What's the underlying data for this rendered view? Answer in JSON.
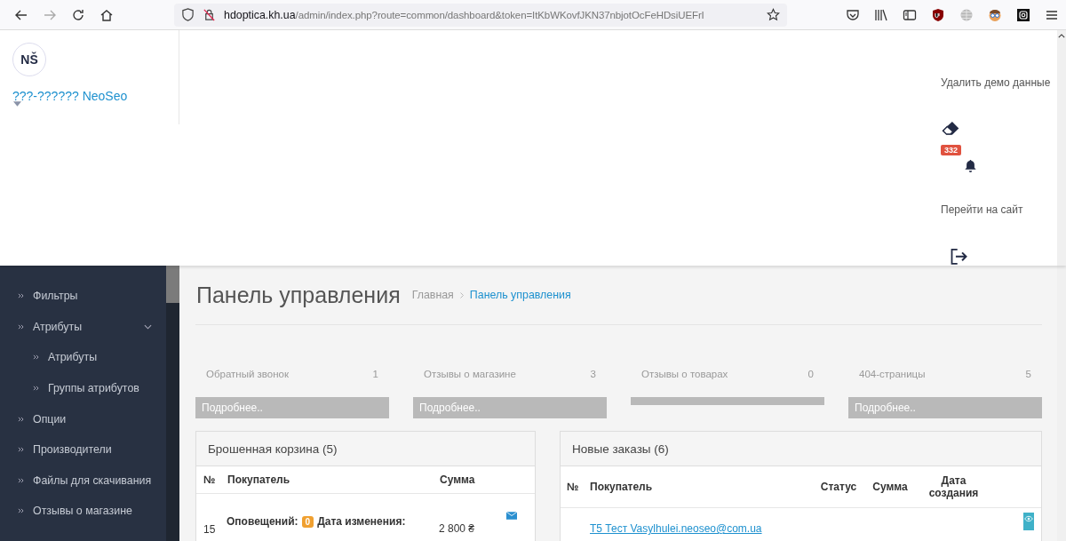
{
  "browser": {
    "url_host": "hdoptica.kh.ua",
    "url_path": "/admin/index.php?route=common/dashboard&token=ItKbWKovfJKN37nbjotOcFeHDsiUEFrI"
  },
  "header": {
    "logo": "NŠ",
    "store_name": "???-?????? NeoSeo",
    "delete_demo": "Удалить демо данные",
    "notifications_count": "332",
    "go_to_site": "Перейти на сайт"
  },
  "sidebar": {
    "items": [
      {
        "label": "Фильтры"
      },
      {
        "label": "Атрибуты",
        "expanded": true,
        "children": [
          {
            "label": "Атрибуты"
          },
          {
            "label": "Группы атрибутов"
          }
        ]
      },
      {
        "label": "Опции"
      },
      {
        "label": "Производители"
      },
      {
        "label": "Файлы для скачивания"
      },
      {
        "label": "Отзывы о магазине"
      }
    ]
  },
  "page": {
    "title": "Панель управления",
    "breadcrumbs": [
      {
        "label": "Главная",
        "selected": false
      },
      {
        "label": "Панель управления",
        "selected": true
      }
    ]
  },
  "stats": [
    {
      "label": "Обратный звонок",
      "count": "1",
      "more": "Подробнее.."
    },
    {
      "label": "Отзывы о магазине",
      "count": "3",
      "more": "Подробнее.."
    },
    {
      "label": "Отзывы о товарах",
      "count": "0"
    },
    {
      "label": "404-страницы",
      "count": "5",
      "more": "Подробнее.."
    }
  ],
  "abandoned_cart": {
    "title": "Брошенная корзина (5)",
    "columns": [
      "№",
      "Покупатель",
      "Сумма"
    ],
    "rows": [
      {
        "number": "15",
        "notifications_label": "Оповещений:",
        "notifications": "0",
        "date_label": "Дата изменения:",
        "sum": "2 800 ₴"
      }
    ]
  },
  "new_orders": {
    "title": "Новые заказы (6)",
    "columns": [
      "№",
      "Покупатель",
      "Статус",
      "Сумма",
      "Дата создания"
    ],
    "rows": [
      {
        "customer": "T5 Тест Vasylhulei.neoseo@com.ua"
      }
    ]
  }
}
